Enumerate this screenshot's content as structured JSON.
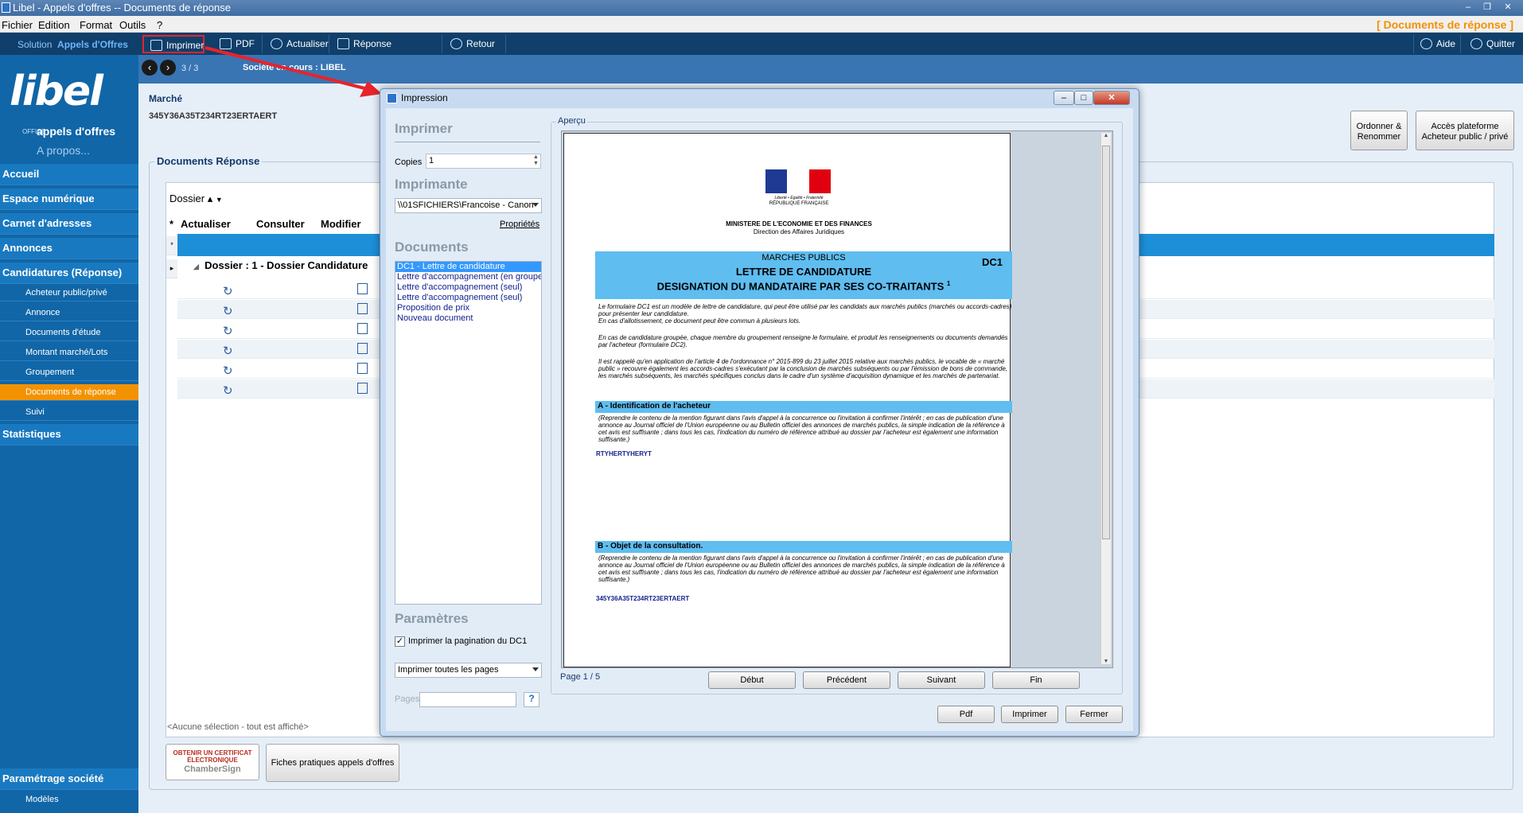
{
  "window": {
    "title": "Libel - Appels d'offres -- Documents de réponse",
    "right_label": "[ Documents de réponse ]"
  },
  "menu": [
    "Fichier",
    "Edition",
    "Format",
    "Outils",
    "?"
  ],
  "toolbar": {
    "solution_prefix": "Solution",
    "solution_name": "Appels d'Offres",
    "buttons": [
      "Imprimer",
      "PDF",
      "Actualiser",
      "Réponse électronique",
      "Retour"
    ],
    "aide": "Aide",
    "quitter": "Quitter"
  },
  "subheader": {
    "counter": "3 / 3",
    "societe": "Société en cours :  LIBEL"
  },
  "sidebar": {
    "logo_main": "libel",
    "logo_office": "OFFICE",
    "logo_sub": "appels d'offres",
    "apropos": "A propos...",
    "items": [
      {
        "label": "Accueil",
        "type": "main"
      },
      {
        "label": "Espace numérique",
        "type": "main"
      },
      {
        "label": "Carnet d'adresses",
        "type": "main"
      },
      {
        "label": "Annonces",
        "type": "main"
      },
      {
        "label": "Candidatures  (Réponse)",
        "type": "main"
      },
      {
        "label": "Acheteur public/privé",
        "type": "sub"
      },
      {
        "label": "Annonce",
        "type": "sub"
      },
      {
        "label": "Documents d'étude",
        "type": "sub"
      },
      {
        "label": "Montant marché/Lots",
        "type": "sub"
      },
      {
        "label": "Groupement",
        "type": "sub"
      },
      {
        "label": "Documents de réponse",
        "type": "sub-active"
      },
      {
        "label": "Suivi",
        "type": "sub"
      },
      {
        "label": "Statistiques",
        "type": "main"
      }
    ],
    "bottom_main": "Paramétrage société",
    "bottom_sub": "Modèles"
  },
  "main": {
    "marche_label": "Marché",
    "marche_ref": "345Y36A35T234RT23ERTAERT",
    "btn_ordonner": [
      "Ordonner &",
      "Renommer"
    ],
    "btn_acces": [
      "Accès plateforme",
      "Acheteur public / privé"
    ],
    "section_title": "Documents Réponse",
    "group_by": "Dossier",
    "columns": [
      "Actualiser",
      "Consulter",
      "Modifier"
    ],
    "dossier_row": "Dossier : 1 - Dossier Candidature",
    "footnote": "<Aucune sélection - tout est affiché>",
    "cert_btn": [
      "OBTENIR UN CERTIFICAT",
      "ÉLECTRONIQUE",
      "ChamberSign"
    ],
    "fiches_btn": "Fiches pratiques appels d'offres"
  },
  "dialog": {
    "title": "Impression",
    "imprimer_header": "Imprimer",
    "copies_label": "Copies",
    "copies_value": "1",
    "imprimante_header": "Imprimante",
    "printer": "\\\\01SFICHIERS\\Francoise - Canon",
    "proprietes": "Propriétés",
    "documents_header": "Documents",
    "documents": [
      "DC1 - Lettre de candidature",
      "Lettre d'accompagnement (en groupe",
      "Lettre d'accompagnement (seul)",
      "Lettre d'accompagnement (seul)",
      "Proposition de prix",
      "Nouveau document"
    ],
    "parametres_header": "Paramètres",
    "checkbox_label": "Imprimer la pagination du DC1",
    "pages_select": "Imprimer toutes les pages",
    "pages_label": "Pages",
    "apercu_label": "Aperçu",
    "page_info": "Page 1 / 5",
    "nav_buttons": [
      "Début",
      "Précédent",
      "Suivant",
      "Fin"
    ],
    "footer_buttons": [
      "Pdf",
      "Imprimer",
      "Fermer"
    ]
  },
  "preview": {
    "flag_caption": [
      "Liberté • Égalité • Fraternité",
      "RÉPUBLIQUE FRANÇAISE"
    ],
    "ministry": "MINISTERE DE L'ECONOMIE ET DES FINANCES",
    "direction": "Direction des Affaires Juridiques",
    "band_top": "MARCHES PUBLICS",
    "band_code": "DC1",
    "title1": "LETTRE DE CANDIDATURE",
    "title2": "DESIGNATION DU MANDATAIRE PAR SES CO-TRAITANTS",
    "title2_sup": "1",
    "intro1": "Le formulaire DC1 est un modèle de lettre de candidature, qui peut être utilisé par les candidats aux marchés publics (marchés ou accords-cadres) pour présenter leur candidature.",
    "intro1b": "En cas d'allotissement, ce document peut être commun à plusieurs lots.",
    "intro2": "En cas de candidature groupée, chaque membre du groupement renseigne le formulaire, et produit les renseignements ou documents demandés par l'acheteur (formulaire DC2).",
    "intro3": "Il est rappelé qu'en application de l'article 4 de l'ordonnance n° 2015-899 du 23 juillet 2015 relative aux marchés publics, le vocable de « marché public » recouvre également les accords-cadres s'exécutant par la conclusion de marchés subséquents ou par l'émission de bons de commande, les marchés subséquents, les marchés spécifiques conclus dans le cadre d'un système d'acquisition dynamique et les marchés de partenariat.",
    "sectionA": "A - Identification de l'acheteur",
    "sectionA_text": "(Reprendre le contenu de la mention figurant dans l'avis d'appel à la concurrence ou l'invitation à confirmer l'intérêt ; en cas de publication d'une annonce au Journal officiel de l'Union européenne ou au Bulletin officiel des annonces de marchés publics, la simple indication de la référence à cet avis est suffisante ; dans tous les cas, l'indication du numéro de référence attribué au dossier par l'acheteur est également une information suffisante.)",
    "sectionA_value": "RTYHERTYHERYT",
    "sectionB": "B - Objet de la consultation.",
    "sectionB_text": "(Reprendre le contenu de la mention figurant dans l'avis d'appel à la concurrence ou l'invitation à confirmer l'intérêt ; en cas de publication d'une annonce au Journal officiel de l'Union européenne ou au Bulletin officiel des annonces de marchés publics, la simple indication de la référence à cet avis est suffisante ; dans tous les cas, l'indication du numéro de référence attribué au dossier par l'acheteur est également une information suffisante.)",
    "sectionB_value": "345Y36A35T234RT23ERTAERT"
  }
}
